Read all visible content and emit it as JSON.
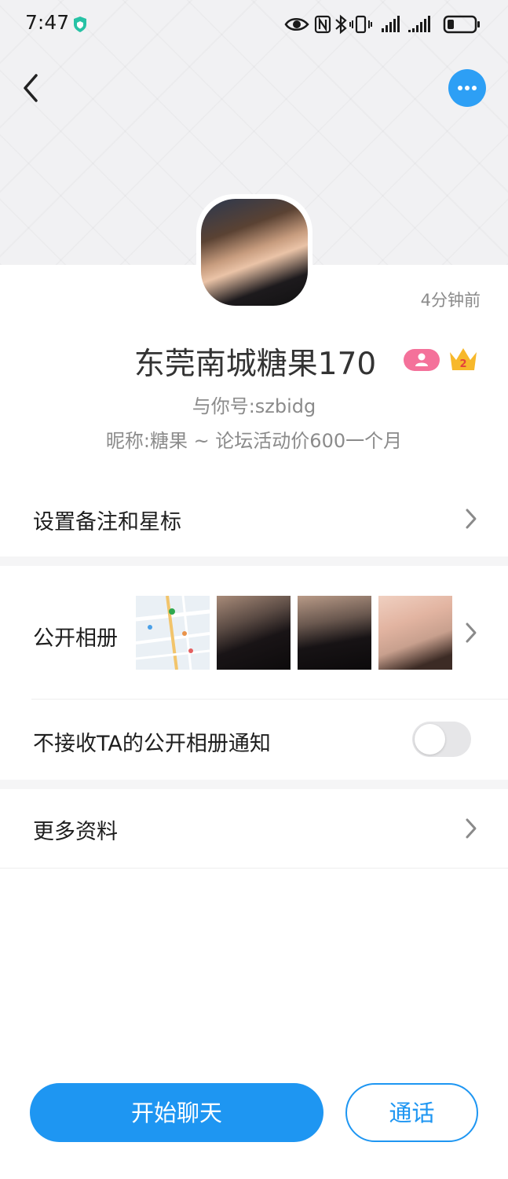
{
  "status_bar": {
    "time": "7:47",
    "icons": [
      "shield-icon",
      "eye-icon",
      "nfc-icon",
      "bluetooth-icon",
      "vibrate-icon",
      "signal-icon",
      "signal-icon",
      "battery-icon"
    ]
  },
  "header": {
    "back_icon": "chevron-left-icon",
    "more_icon": "more-dots-icon"
  },
  "profile": {
    "last_seen": "4分钟前",
    "name": "东莞南城糖果170",
    "account_id": "与你号:szbidg",
    "nickname": "昵称:糖果 ~ 论坛活动价600一个月",
    "badge_level": "2"
  },
  "rows": {
    "remark": "设置备注和星标",
    "album": "公开相册",
    "mute_album": "不接收TA的公开相册通知",
    "more_info": "更多资料"
  },
  "mute_album_toggle_on": false,
  "buttons": {
    "chat": "开始聊天",
    "call": "通话"
  },
  "colors": {
    "accent": "#1e96f2",
    "gender_badge": "#f4719a",
    "crown": "#f7b82b"
  }
}
